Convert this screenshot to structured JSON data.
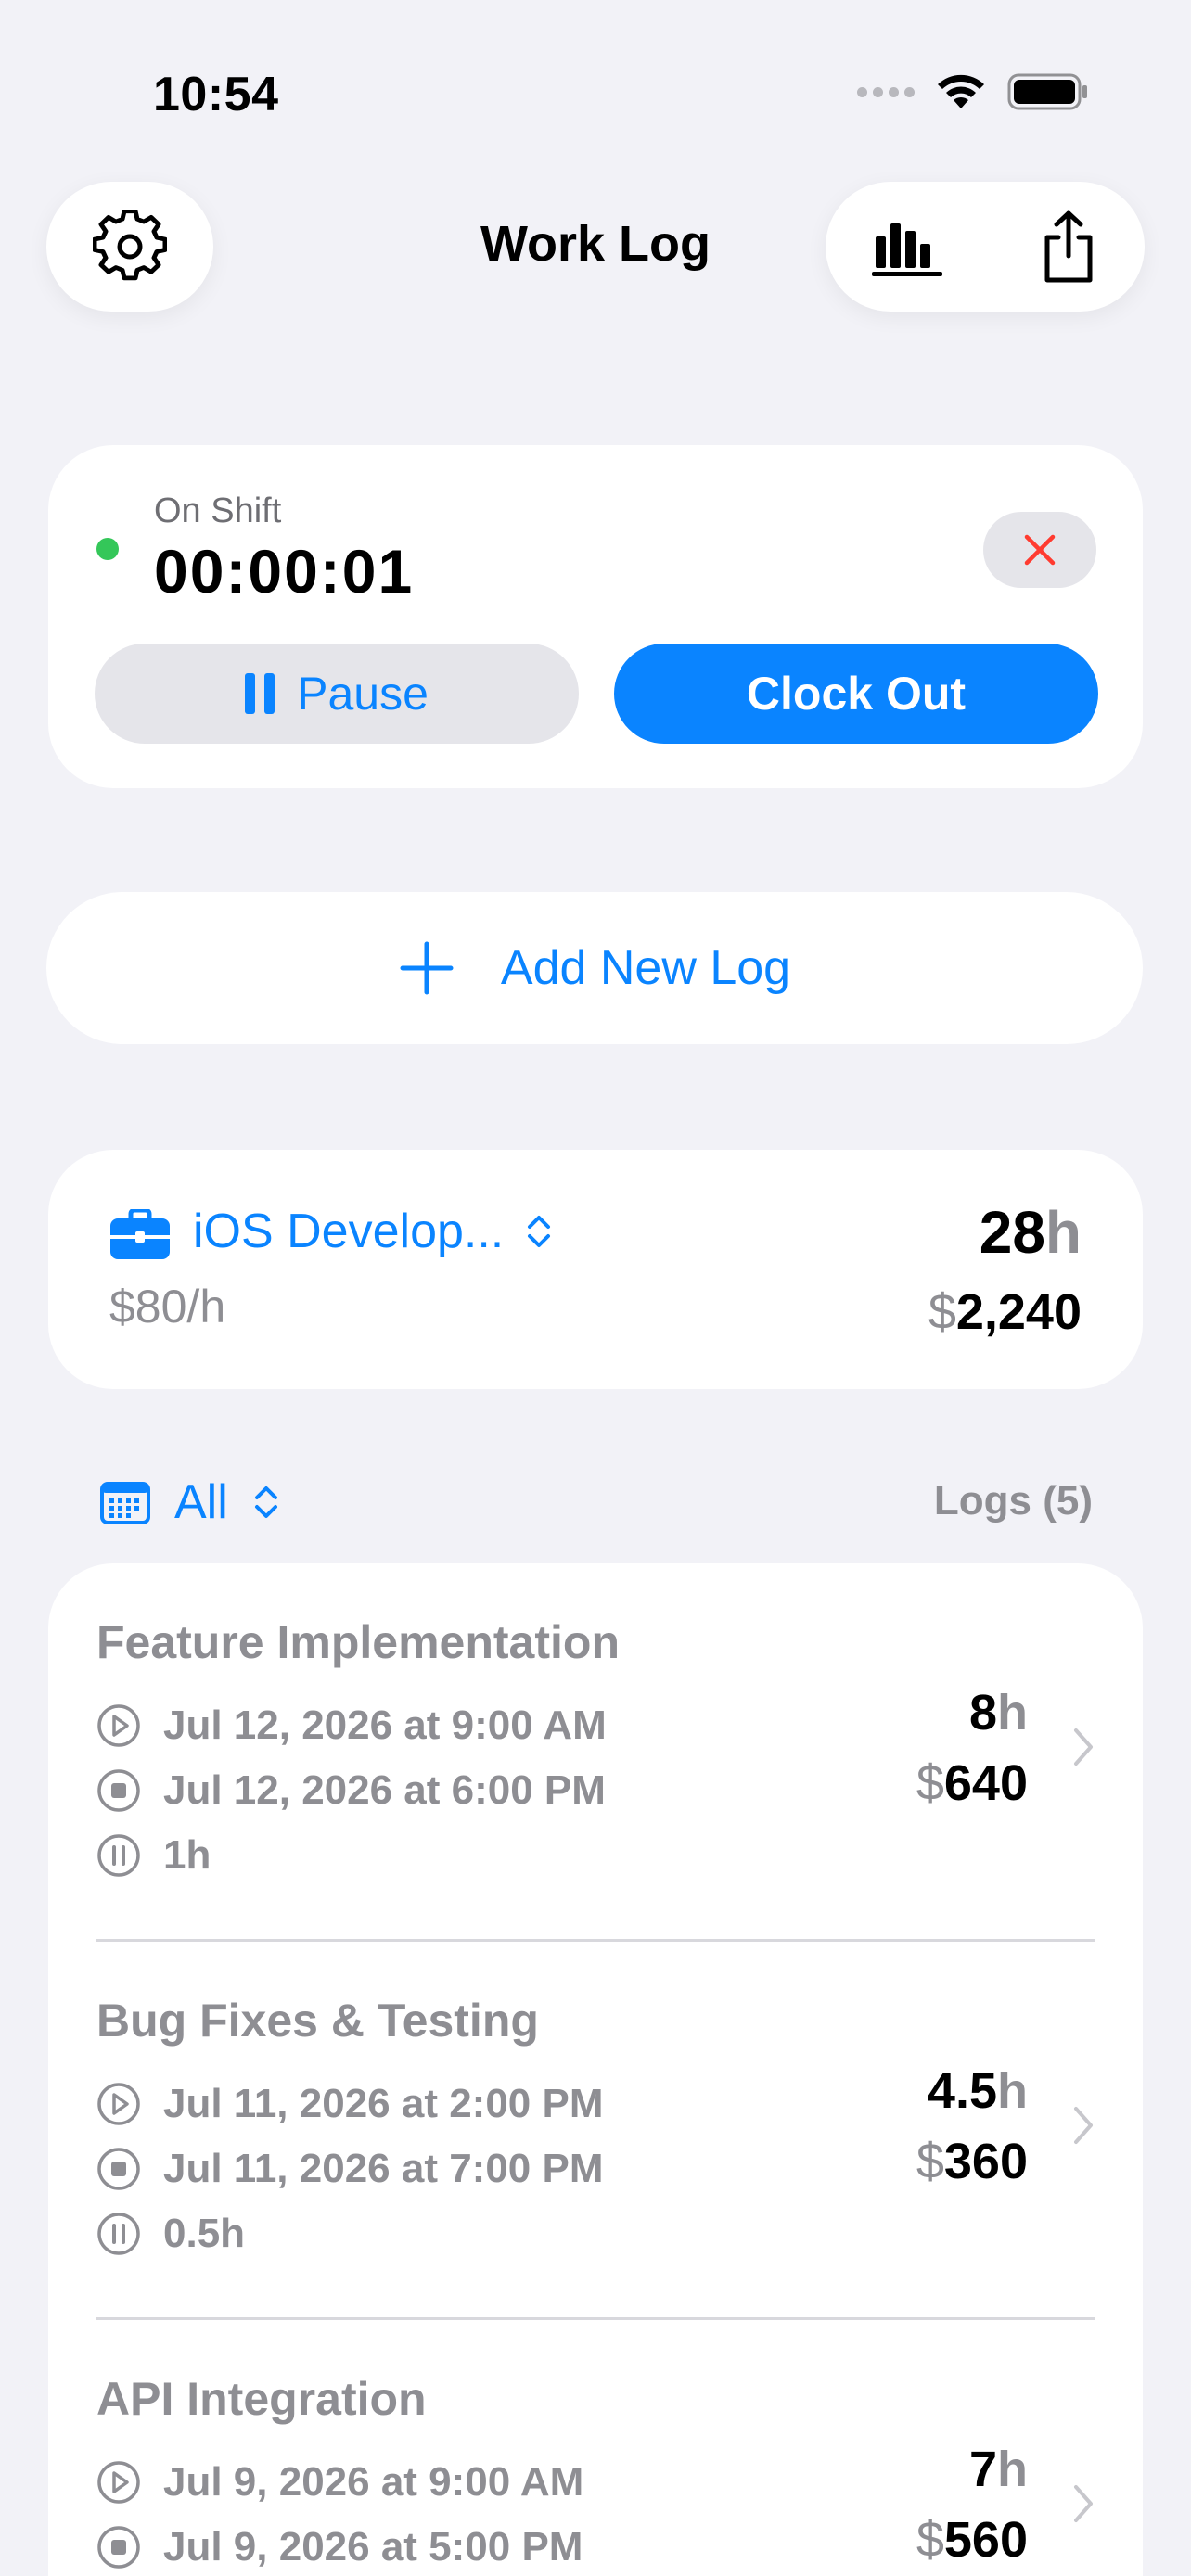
{
  "status_bar": {
    "time": "10:54"
  },
  "header": {
    "title": "Work Log"
  },
  "shift": {
    "status_label": "On Shift",
    "timer": "00:00:01",
    "pause_label": "Pause",
    "clock_out_label": "Clock Out"
  },
  "add_log": {
    "label": "Add New Log"
  },
  "project": {
    "name": "iOS Develop...",
    "rate": "$80/h",
    "hours_value": "28",
    "hours_unit": "h",
    "currency": "$",
    "amount": "2,240"
  },
  "filter": {
    "label": "All",
    "logs_count": "Logs (5)"
  },
  "logs": [
    {
      "title": "Feature Implementation",
      "start": "Jul 12, 2026 at 9:00 AM",
      "end": "Jul 12, 2026 at 6:00 PM",
      "pause": "1h",
      "hours": "8",
      "hours_unit": "h",
      "currency": "$",
      "amount": "640"
    },
    {
      "title": "Bug Fixes & Testing",
      "start": "Jul 11, 2026 at 2:00 PM",
      "end": "Jul 11, 2026 at 7:00 PM",
      "pause": "0.5h",
      "hours": "4.5",
      "hours_unit": "h",
      "currency": "$",
      "amount": "360"
    },
    {
      "title": "API Integration",
      "start": "Jul 9, 2026 at 9:00 AM",
      "end": "Jul 9, 2026 at 5:00 PM",
      "pause": "",
      "hours": "7",
      "hours_unit": "h",
      "currency": "$",
      "amount": "560"
    }
  ],
  "colors": {
    "accent": "#0a84ff",
    "on_shift": "#34c759",
    "cancel": "#ff3b30",
    "background": "#f2f2f7"
  }
}
